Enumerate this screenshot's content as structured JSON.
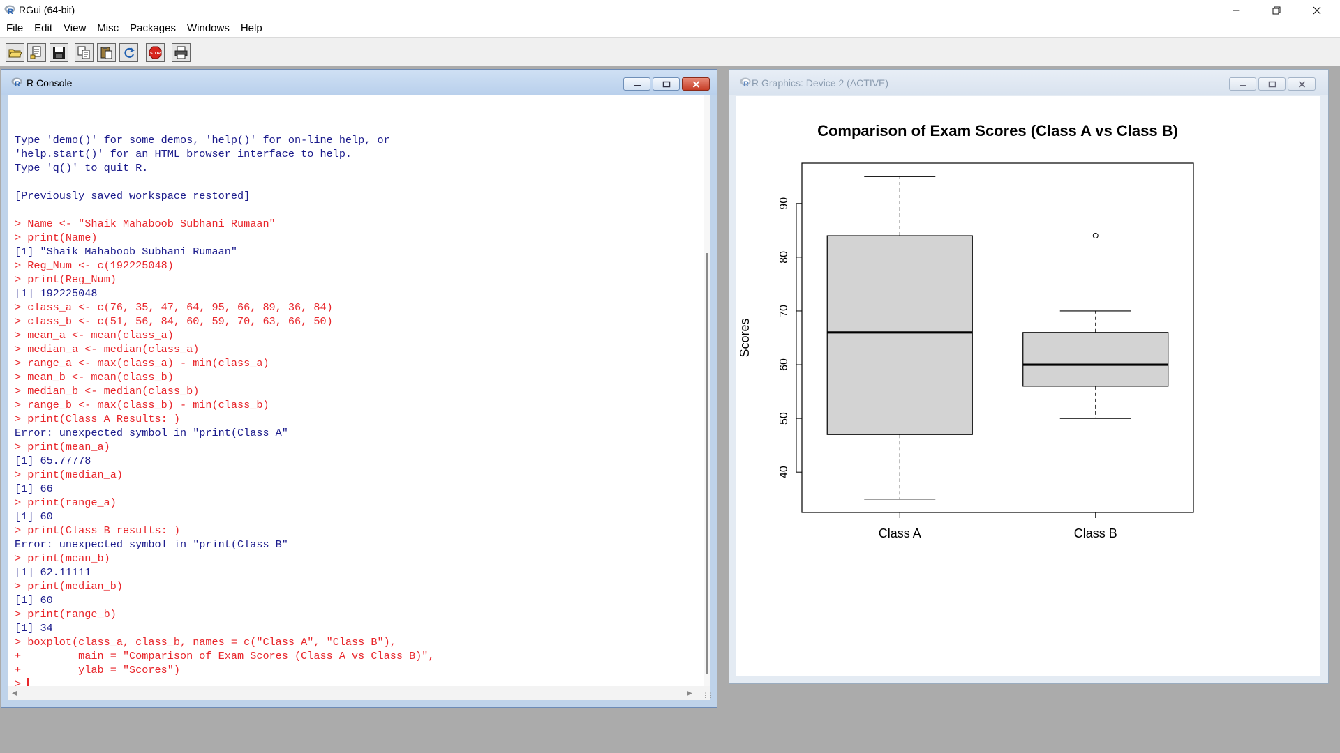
{
  "app": {
    "title": "RGui (64-bit)"
  },
  "menu": [
    "File",
    "Edit",
    "View",
    "Misc",
    "Packages",
    "Windows",
    "Help"
  ],
  "toolbar": {
    "buttons": [
      "open-script-icon",
      "load-workspace-icon",
      "save-workspace-icon",
      "copy-icon",
      "paste-icon",
      "copy-paste-icon",
      "stop-icon",
      "print-icon"
    ]
  },
  "console": {
    "title": "R Console",
    "lines": [
      {
        "text": "",
        "kind": "out"
      },
      {
        "text": "Type 'demo()' for some demos, 'help()' for on-line help, or",
        "kind": "out"
      },
      {
        "text": "'help.start()' for an HTML browser interface to help.",
        "kind": "out"
      },
      {
        "text": "Type 'q()' to quit R.",
        "kind": "out"
      },
      {
        "text": "",
        "kind": "out"
      },
      {
        "text": "[Previously saved workspace restored]",
        "kind": "out"
      },
      {
        "text": "",
        "kind": "out"
      },
      {
        "text": "> Name <- \"Shaik Mahaboob Subhani Rumaan\"",
        "kind": "in"
      },
      {
        "text": "> print(Name)",
        "kind": "in"
      },
      {
        "text": "[1] \"Shaik Mahaboob Subhani Rumaan\"",
        "kind": "out"
      },
      {
        "text": "> Reg_Num <- c(192225048)",
        "kind": "in"
      },
      {
        "text": "> print(Reg_Num)",
        "kind": "in"
      },
      {
        "text": "[1] 192225048",
        "kind": "out"
      },
      {
        "text": "> class_a <- c(76, 35, 47, 64, 95, 66, 89, 36, 84)",
        "kind": "in"
      },
      {
        "text": "> class_b <- c(51, 56, 84, 60, 59, 70, 63, 66, 50)",
        "kind": "in"
      },
      {
        "text": "> mean_a <- mean(class_a)",
        "kind": "in"
      },
      {
        "text": "> median_a <- median(class_a)",
        "kind": "in"
      },
      {
        "text": "> range_a <- max(class_a) - min(class_a)",
        "kind": "in"
      },
      {
        "text": "> mean_b <- mean(class_b)",
        "kind": "in"
      },
      {
        "text": "> median_b <- median(class_b)",
        "kind": "in"
      },
      {
        "text": "> range_b <- max(class_b) - min(class_b)",
        "kind": "in"
      },
      {
        "text": "> print(Class A Results: )",
        "kind": "in"
      },
      {
        "text": "Error: unexpected symbol in \"print(Class A\"",
        "kind": "out"
      },
      {
        "text": "> print(mean_a)",
        "kind": "in"
      },
      {
        "text": "[1] 65.77778",
        "kind": "out"
      },
      {
        "text": "> print(median_a)",
        "kind": "in"
      },
      {
        "text": "[1] 66",
        "kind": "out"
      },
      {
        "text": "> print(range_a)",
        "kind": "in"
      },
      {
        "text": "[1] 60",
        "kind": "out"
      },
      {
        "text": "> print(Class B results: )",
        "kind": "in"
      },
      {
        "text": "Error: unexpected symbol in \"print(Class B\"",
        "kind": "out"
      },
      {
        "text": "> print(mean_b)",
        "kind": "in"
      },
      {
        "text": "[1] 62.11111",
        "kind": "out"
      },
      {
        "text": "> print(median_b)",
        "kind": "in"
      },
      {
        "text": "[1] 60",
        "kind": "out"
      },
      {
        "text": "> print(range_b)",
        "kind": "in"
      },
      {
        "text": "[1] 34",
        "kind": "out"
      },
      {
        "text": "> boxplot(class_a, class_b, names = c(\"Class A\", \"Class B\"),",
        "kind": "in"
      },
      {
        "text": "+         main = \"Comparison of Exam Scores (Class A vs Class B)\",",
        "kind": "in"
      },
      {
        "text": "+         ylab = \"Scores\")",
        "kind": "in"
      }
    ],
    "prompt": "> "
  },
  "graphics": {
    "title": "R Graphics: Device 2 (ACTIVE)"
  },
  "colors": {
    "input_text": "#e8262b",
    "output_text": "#1c1c8c",
    "box_fill": "#d3d3d3"
  },
  "chart_data": {
    "type": "boxplot",
    "title": "Comparison of Exam Scores (Class A vs Class B)",
    "xlabel": "",
    "ylabel": "Scores",
    "ylim": [
      32.5,
      97.5
    ],
    "yticks": [
      40,
      50,
      60,
      70,
      80,
      90
    ],
    "categories": [
      "Class A",
      "Class B"
    ],
    "boxes": [
      {
        "name": "Class A",
        "min": 35,
        "q1": 47,
        "median": 66,
        "q3": 84,
        "max": 95,
        "outliers": []
      },
      {
        "name": "Class B",
        "min": 50,
        "q1": 56,
        "median": 60,
        "q3": 66,
        "max": 70,
        "outliers": [
          84
        ]
      }
    ],
    "grid": false,
    "legend": "none"
  }
}
